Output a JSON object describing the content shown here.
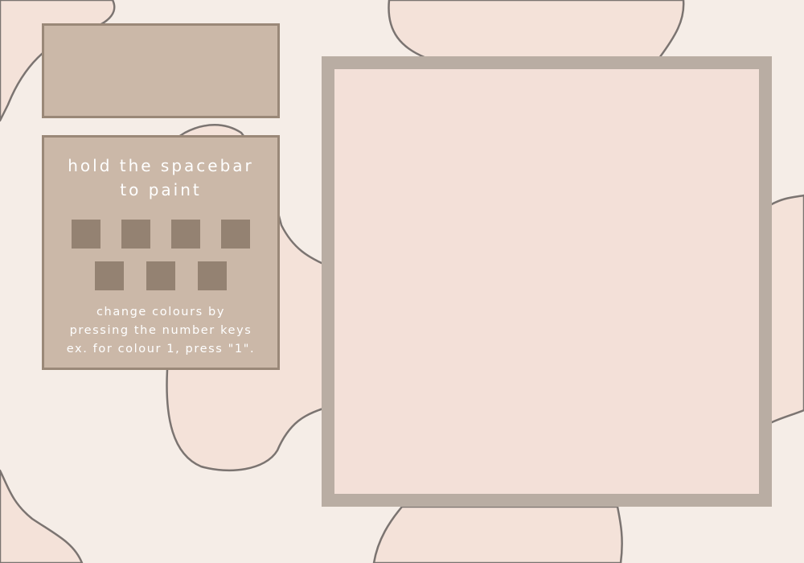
{
  "title_box": {
    "text": ""
  },
  "instructions": {
    "heading_line1": "hold the spacebar",
    "heading_line2": "to paint",
    "hint_line1": "change colours by",
    "hint_line2": "pressing the number keys",
    "hint_line3": "ex. for colour 1, press \"1\"."
  },
  "palette": {
    "row1": [
      {
        "color": "#948272"
      },
      {
        "color": "#948272"
      },
      {
        "color": "#948272"
      },
      {
        "color": "#948272"
      }
    ],
    "row2": [
      {
        "color": "#948272"
      },
      {
        "color": "#948272"
      },
      {
        "color": "#948272"
      }
    ]
  },
  "colors": {
    "background": "#f5ede7",
    "blob_fill": "#f4e2d9",
    "blob_outline": "#7b7471",
    "panel": "#cbb8a8",
    "panel_border": "#9a8878",
    "canvas_frame": "#b9ada3",
    "canvas": "#f3e0d8",
    "text": "#ffffff"
  }
}
